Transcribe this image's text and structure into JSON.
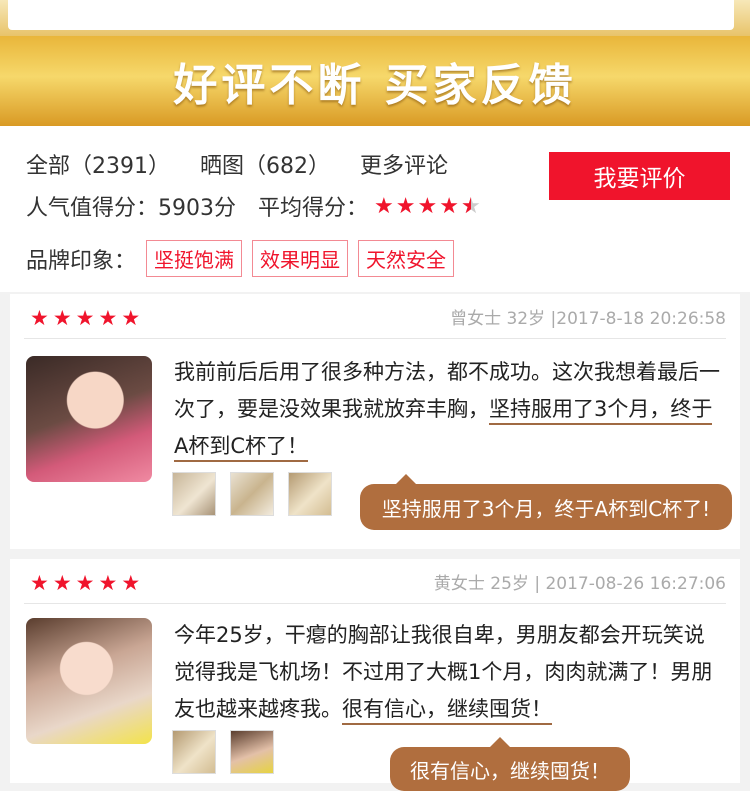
{
  "banner": {
    "title": "好评不断  买家反馈"
  },
  "summary": {
    "all": "全部（2391）",
    "photos": "晒图（682）",
    "more": "更多评论",
    "review_button": "我要评价",
    "popularity": "人气值得分：5903分",
    "avg_label": "平均得分：",
    "avg_rating": 4.5,
    "brand_label": "品牌印象：",
    "tags": [
      "坚挺饱满",
      "效果明显",
      "天然安全"
    ]
  },
  "reviews": [
    {
      "rating": 5,
      "user": "曾女士 32岁",
      "date": "|2017-8-18 20:26:58",
      "text_plain": "我前前后后用了很多种方法，都不成功。这次我想着最后一次了，要是没效果我就放弃丰胸，",
      "text_highlight": "坚持服用了3个月，终于A杯到C杯了！",
      "bubble": "坚持服用了3个月，终于A杯到C杯了!",
      "thumb_count": 3
    },
    {
      "rating": 5,
      "user": "黄女士 25岁",
      "date": "| 2017-08-26 16:27:06",
      "text_plain": "今年25岁，干瘪的胸部让我很自卑，男朋友都会开玩笑说觉得我是飞机场！不过用了大概1个月，肉肉就满了！男朋友也越来越疼我。",
      "text_highlight": "很有信心，继续囤货！",
      "bubble": "很有信心，继续囤货！",
      "thumb_count": 2
    }
  ],
  "colors": {
    "accent": "#f0142c",
    "gold": "#e9b63a",
    "bubble": "#b06e3e"
  }
}
